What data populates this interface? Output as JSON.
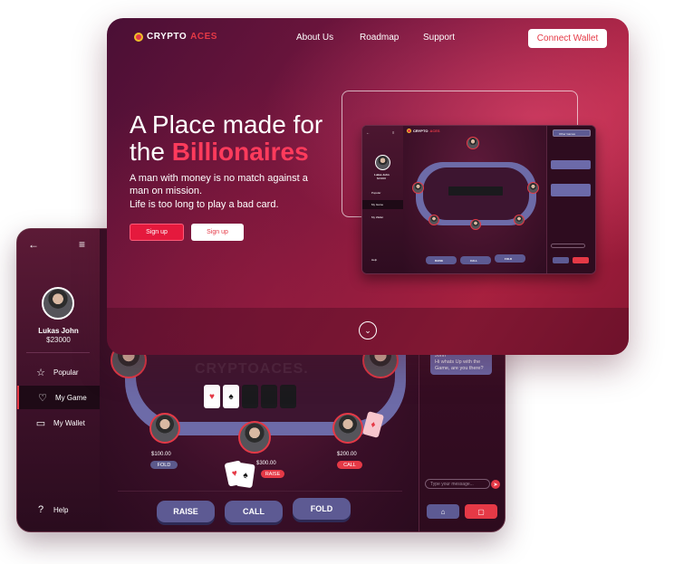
{
  "brand": {
    "name_part1": "CRYPTO",
    "name_part2": "ACES"
  },
  "nav": {
    "about": "About Us",
    "roadmap": "Roadmap",
    "support": "Support",
    "connect": "Connect Wallet"
  },
  "hero": {
    "title_line1": "A Place made for",
    "title_the": "the ",
    "title_highlight": "Billionaires",
    "para1": "A man with money is no match against a man on mission.",
    "para2": "Life is too long to play  a bad card.",
    "signup_primary": "Sign up",
    "signup_secondary": "Sign up"
  },
  "profile": {
    "name": "Lukas John",
    "balance": "$23000"
  },
  "sidebar": {
    "items": [
      {
        "label": "Popular",
        "icon": "star-icon"
      },
      {
        "label": "My Game",
        "icon": "heart-icon"
      },
      {
        "label": "My Wallet",
        "icon": "wallet-icon"
      }
    ],
    "help": "Help"
  },
  "table": {
    "watermark": "CRYPTOACES.",
    "community_cards": [
      "♥",
      "♠"
    ],
    "players": [
      {
        "amount": "$100.00",
        "action": "FOLD"
      },
      {
        "amount": "$300.00",
        "action": "RAISE"
      },
      {
        "amount": "$200.00",
        "action": "CALL"
      }
    ]
  },
  "actions": {
    "raise": "RAISE",
    "call": "CALL",
    "fold": "FOLD"
  },
  "chat": {
    "sender": "John",
    "message": "Hi whats Up with the Game, are you there?",
    "input_placeholder": "Type your message..."
  },
  "mini": {
    "name": "Lukas John",
    "balance": "$23000",
    "popular": "Popular",
    "mygame": "My Game",
    "mywallet": "My Wallet",
    "help": "Help",
    "raise": "RAISE",
    "call": "CALL",
    "fold": "FOLD",
    "other_games": "Other Games"
  },
  "colors": {
    "accent": "#e53946",
    "button": "#5d5a93",
    "bg_dark": "#2b0d21"
  }
}
